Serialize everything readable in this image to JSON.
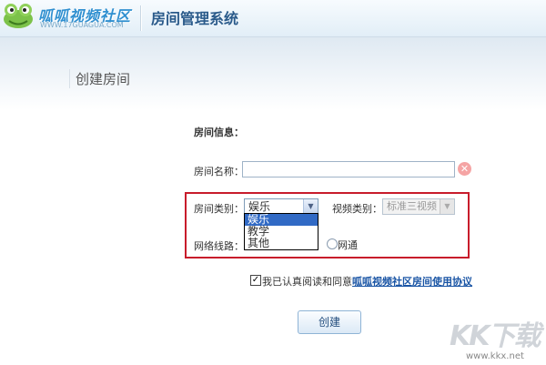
{
  "header": {
    "logo_text": "呱呱视频社区",
    "logo_url": "WWW.17GUAGUA.COM",
    "system_title": "房间管理系统"
  },
  "page": {
    "title": "创建房间"
  },
  "form": {
    "section_title": "房间信息：",
    "name_label": "房间名称：",
    "name_value": "",
    "type_label": "房间类别：",
    "type_selected": "娱乐",
    "type_options": [
      "娱乐",
      "教学",
      "其他"
    ],
    "video_label": "视频类别：",
    "video_selected": "标准三视频",
    "network_label": "网络线路：",
    "network_option": "网通",
    "agree_prefix": "我已认真阅读和同意",
    "agree_link": "呱呱视频社区房间使用协议",
    "create_button": "创建"
  },
  "watermark": {
    "text": "KK下载",
    "url": "www.kkx.net"
  },
  "colors": {
    "highlight": "#c81c2b",
    "brand": "#2f8fd0",
    "link": "#1a55a5",
    "selection": "#316ac5"
  }
}
